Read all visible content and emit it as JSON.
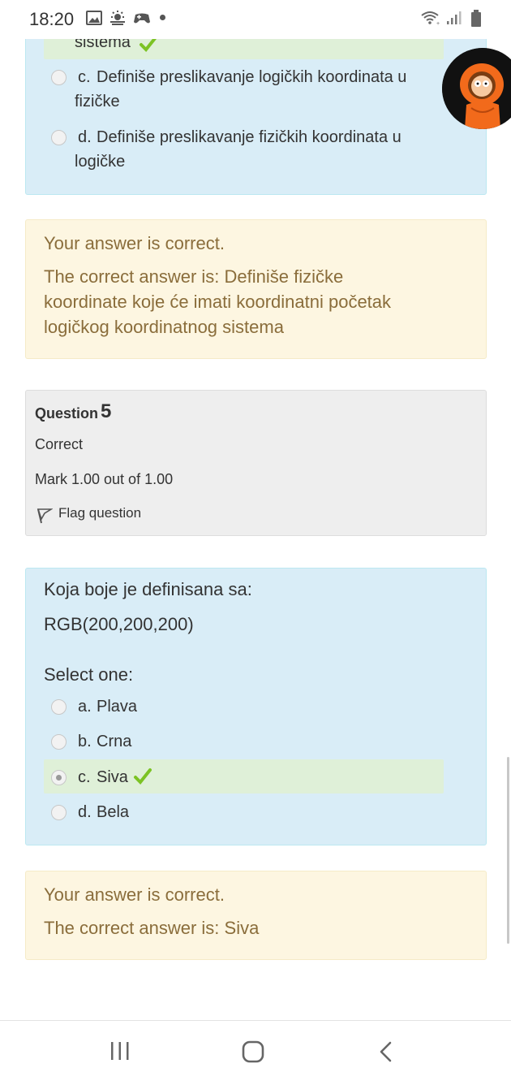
{
  "status_bar": {
    "time": "18:20",
    "icons": [
      "image-icon",
      "weather-icon",
      "game-controller-icon",
      "dot-icon"
    ],
    "right_icons": [
      "wifi-icon",
      "signal-icon",
      "battery-icon"
    ]
  },
  "question4": {
    "partial_option_text": "sistema",
    "options": [
      {
        "letter": "c.",
        "text_line1": "Definiše preslikavanje logičkih koordinata u",
        "text_line2": "fizičke"
      },
      {
        "letter": "d.",
        "text_line1": "Definiše preslikavanje fizičkih koordinata u",
        "text_line2": "logičke"
      }
    ],
    "feedback": {
      "status": "Your answer is correct.",
      "answer_line1": "The correct answer is: Definiše fizičke",
      "answer_line2": "koordinate koje će imati koordinatni početak",
      "answer_line3": "logičkog koordinatnog sistema"
    }
  },
  "question5": {
    "info": {
      "label": "Question",
      "number": "5",
      "state": "Correct",
      "mark": "Mark 1.00 out of 1.00",
      "flag": "Flag question"
    },
    "prompt": "Koja boje je definisana sa:",
    "value": "RGB(200,200,200)",
    "select_label": "Select one:",
    "options": [
      {
        "letter": "a.",
        "text": "Plava"
      },
      {
        "letter": "b.",
        "text": "Crna"
      },
      {
        "letter": "c.",
        "text": "Siva"
      },
      {
        "letter": "d.",
        "text": "Bela"
      }
    ],
    "selected_index": 2,
    "feedback": {
      "status": "Your answer is correct.",
      "answer": "The correct answer is: Siva"
    }
  },
  "nav": {
    "recent_icon": "recent-apps-icon",
    "home_icon": "home-icon",
    "back_icon": "back-icon"
  },
  "colors": {
    "question_bg": "#d9edf7",
    "feedback_bg": "#fdf6e1",
    "info_bg": "#eeeeee",
    "correct_bg": "#dff0d8",
    "check": "#7cc324",
    "feedback_text": "#8a6d3b"
  }
}
